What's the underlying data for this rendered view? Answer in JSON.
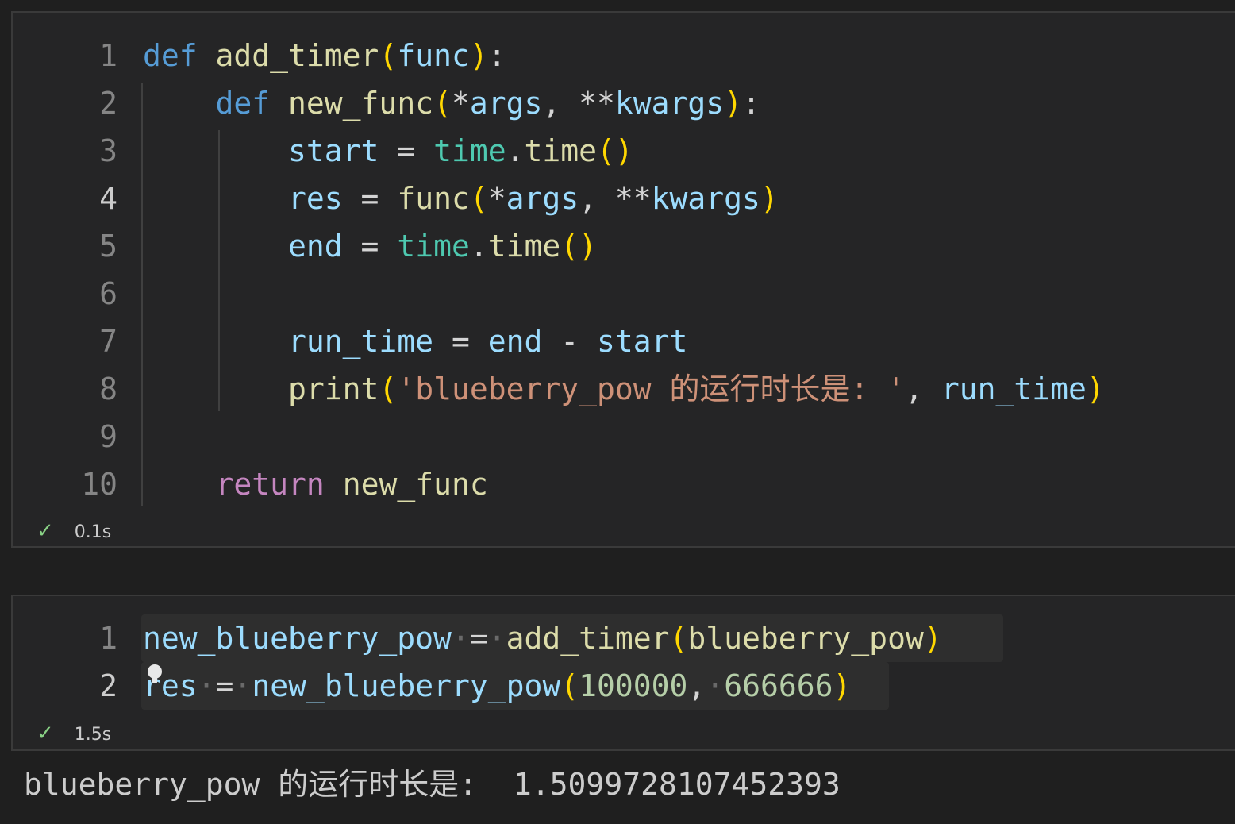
{
  "cells": [
    {
      "lines": [
        {
          "n": "1",
          "tokens": [
            {
              "t": "def",
              "c": "kw"
            },
            {
              "t": " ",
              "c": "op"
            },
            {
              "t": "add_timer",
              "c": "fn"
            },
            {
              "t": "(",
              "c": "p1"
            },
            {
              "t": "func",
              "c": "var"
            },
            {
              "t": ")",
              "c": "p1"
            },
            {
              "t": ":",
              "c": "op"
            }
          ]
        },
        {
          "n": "2",
          "tokens": [
            {
              "t": "    ",
              "c": "op"
            },
            {
              "t": "def",
              "c": "kw"
            },
            {
              "t": " ",
              "c": "op"
            },
            {
              "t": "new_func",
              "c": "fn"
            },
            {
              "t": "(",
              "c": "p1"
            },
            {
              "t": "*",
              "c": "op"
            },
            {
              "t": "args",
              "c": "var"
            },
            {
              "t": ", ",
              "c": "op"
            },
            {
              "t": "**",
              "c": "op"
            },
            {
              "t": "kwargs",
              "c": "var"
            },
            {
              "t": ")",
              "c": "p1"
            },
            {
              "t": ":",
              "c": "op"
            }
          ]
        },
        {
          "n": "3",
          "tokens": [
            {
              "t": "        ",
              "c": "op"
            },
            {
              "t": "start",
              "c": "var"
            },
            {
              "t": " = ",
              "c": "op"
            },
            {
              "t": "time",
              "c": "mod"
            },
            {
              "t": ".",
              "c": "op"
            },
            {
              "t": "time",
              "c": "fn"
            },
            {
              "t": "()",
              "c": "p1"
            }
          ]
        },
        {
          "n": "4",
          "tokens": [
            {
              "t": "        ",
              "c": "op"
            },
            {
              "t": "res",
              "c": "var"
            },
            {
              "t": " = ",
              "c": "op"
            },
            {
              "t": "func",
              "c": "fn"
            },
            {
              "t": "(",
              "c": "p1"
            },
            {
              "t": "*",
              "c": "op"
            },
            {
              "t": "args",
              "c": "var"
            },
            {
              "t": ", ",
              "c": "op"
            },
            {
              "t": "**",
              "c": "op"
            },
            {
              "t": "kwargs",
              "c": "var"
            },
            {
              "t": ")",
              "c": "p1"
            }
          ]
        },
        {
          "n": "5",
          "tokens": [
            {
              "t": "        ",
              "c": "op"
            },
            {
              "t": "end",
              "c": "var"
            },
            {
              "t": " = ",
              "c": "op"
            },
            {
              "t": "time",
              "c": "mod"
            },
            {
              "t": ".",
              "c": "op"
            },
            {
              "t": "time",
              "c": "fn"
            },
            {
              "t": "()",
              "c": "p1"
            }
          ]
        },
        {
          "n": "6",
          "tokens": []
        },
        {
          "n": "7",
          "tokens": [
            {
              "t": "        ",
              "c": "op"
            },
            {
              "t": "run_time",
              "c": "var"
            },
            {
              "t": " = ",
              "c": "op"
            },
            {
              "t": "end",
              "c": "var"
            },
            {
              "t": " - ",
              "c": "op"
            },
            {
              "t": "start",
              "c": "var"
            }
          ]
        },
        {
          "n": "8",
          "tokens": [
            {
              "t": "        ",
              "c": "op"
            },
            {
              "t": "print",
              "c": "fn"
            },
            {
              "t": "(",
              "c": "p1"
            },
            {
              "t": "'blueberry_pow 的运行时长是: '",
              "c": "str"
            },
            {
              "t": ", ",
              "c": "op"
            },
            {
              "t": "run_time",
              "c": "var"
            },
            {
              "t": ")",
              "c": "p1"
            }
          ]
        },
        {
          "n": "9",
          "tokens": []
        },
        {
          "n": "10",
          "tokens": [
            {
              "t": "    ",
              "c": "op"
            },
            {
              "t": "return",
              "c": "ctrl"
            },
            {
              "t": " ",
              "c": "op"
            },
            {
              "t": "new_func",
              "c": "fn"
            }
          ]
        }
      ],
      "status": {
        "check": "✓",
        "time": "0.1s"
      }
    },
    {
      "lines": [
        {
          "n": "1",
          "tokens": [
            {
              "t": "new_blueberry_pow",
              "c": "var"
            },
            {
              "t": "·",
              "c": "dot"
            },
            {
              "t": "=",
              "c": "op"
            },
            {
              "t": "·",
              "c": "dot"
            },
            {
              "t": "add_timer",
              "c": "fn"
            },
            {
              "t": "(",
              "c": "p1"
            },
            {
              "t": "blueberry_pow",
              "c": "fn"
            },
            {
              "t": ")",
              "c": "p1"
            }
          ]
        },
        {
          "n": "2",
          "tokens": [
            {
              "t": "res",
              "c": "var"
            },
            {
              "t": "·",
              "c": "dot"
            },
            {
              "t": "=",
              "c": "op"
            },
            {
              "t": "·",
              "c": "dot"
            },
            {
              "t": "new_blueberry_pow",
              "c": "var"
            },
            {
              "t": "(",
              "c": "p1"
            },
            {
              "t": "100000",
              "c": "num"
            },
            {
              "t": ",",
              "c": "op"
            },
            {
              "t": "·",
              "c": "dot"
            },
            {
              "t": "666666",
              "c": "num"
            },
            {
              "t": ")",
              "c": "p1"
            }
          ]
        }
      ],
      "status": {
        "check": "✓",
        "time": "1.5s"
      }
    }
  ],
  "output": {
    "text": "blueberry_pow 的运行时长是:  1.5099728107452393"
  }
}
